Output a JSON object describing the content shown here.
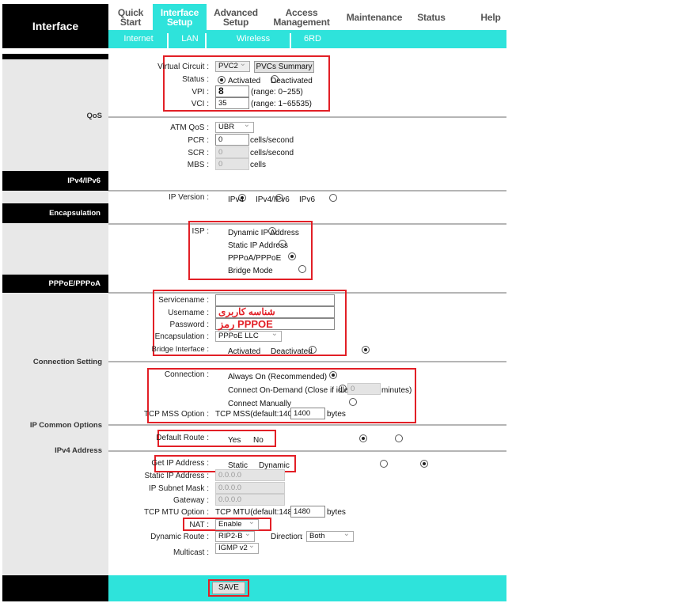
{
  "header": {
    "brand": "Interface",
    "tabs": [
      {
        "label": "Quick Start"
      },
      {
        "label": "Interface Setup"
      },
      {
        "label": "Advanced Setup"
      },
      {
        "label": "Access Management"
      },
      {
        "label": "Maintenance"
      },
      {
        "label": "Status"
      },
      {
        "label": "Help"
      }
    ],
    "subtabs": [
      {
        "label": "Internet"
      },
      {
        "label": "LAN"
      },
      {
        "label": "Wireless"
      },
      {
        "label": "6RD"
      }
    ]
  },
  "sidebar": {
    "qos": "QoS",
    "ipv": "IPv4/IPv6",
    "encap": "Encapsulation",
    "pppoe": "PPPoE/PPPoA",
    "conn": "Connection Setting",
    "ipcommon": "IP Common Options",
    "ipv4": "IPv4 Address"
  },
  "vc": {
    "label": "Virtual Circuit",
    "value": "PVC2",
    "summary": "PVCs Summary",
    "status_label": "Status",
    "activated": "Activated",
    "deactivated": "Deactivated",
    "vpi_label": "VPI",
    "vpi": "8",
    "vpi_range": "(range: 0~255)",
    "vci_label": "VCI",
    "vci": "35",
    "vci_range": "(range: 1~65535)"
  },
  "qos": {
    "atm_label": "ATM QoS",
    "atm": "UBR",
    "pcr_label": "PCR",
    "pcr": "0",
    "scr_label": "SCR",
    "scr": "0",
    "mbs_label": "MBS",
    "mbs": "0",
    "cps": "cells/second",
    "cells": "cells"
  },
  "ipver": {
    "label": "IP Version",
    "opts": [
      "IPv4",
      "IPv4/IPv6",
      "IPv6"
    ]
  },
  "isp": {
    "label": "ISP",
    "opts": [
      "Dynamic IP Address",
      "Static IP Address",
      "PPPoA/PPPoE",
      "Bridge Mode"
    ]
  },
  "pppoe": {
    "service_label": "Servicename",
    "service": "",
    "user_label": "Username",
    "user": "شناسه کاربری",
    "pass_label": "Password",
    "pass": "رمز PPPOE",
    "encap_label": "Encapsulation",
    "encap": "PPPoE LLC",
    "bridge_label": "Bridge Interface",
    "activated": "Activated",
    "deactivated": "Deactivated"
  },
  "conn": {
    "label": "Connection",
    "always": "Always On (Recommended)",
    "ondemand": "Connect On-Demand (Close if idle for",
    "idle": "0",
    "minutes": "minutes)",
    "manual": "Connect Manually",
    "mss_label": "TCP MSS Option",
    "mss_text": "TCP MSS(default:1400)",
    "mss": "1400",
    "bytes": "bytes"
  },
  "common": {
    "route_label": "Default Route",
    "yes": "Yes",
    "no": "No"
  },
  "ipv4": {
    "get_label": "Get IP Address",
    "static": "Static",
    "dynamic": "Dynamic",
    "sip_label": "Static IP Address",
    "sip": "0.0.0.0",
    "mask_label": "IP Subnet Mask",
    "mask": "0.0.0.0",
    "gw_label": "Gateway",
    "gw": "0.0.0.0",
    "mtu_label": "TCP MTU Option",
    "mtu_text": "TCP MTU(default:1480)",
    "mtu": "1480",
    "bytes": "bytes",
    "nat_label": "NAT",
    "nat": "Enable",
    "dr_label": "Dynamic Route",
    "dr": "RIP2-B",
    "dir_label": "Direction",
    "dir": "Both",
    "mc_label": "Multicast",
    "mc": "IGMP v2"
  },
  "footer": {
    "save": "SAVE"
  },
  "colors": {
    "accent": "#2ee3db",
    "highlight": "#e21f26"
  }
}
